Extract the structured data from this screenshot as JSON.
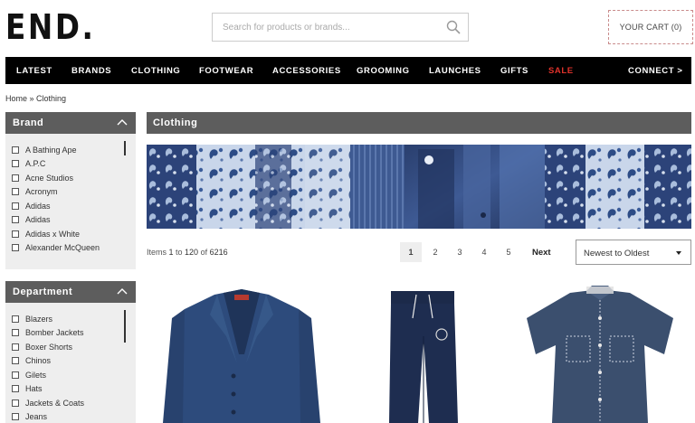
{
  "header": {
    "logo": "END.",
    "search_placeholder": "Search for products or brands...",
    "cart_label": "YOUR CART (0)"
  },
  "nav": {
    "items": [
      "LATEST",
      "BRANDS",
      "CLOTHING",
      "FOOTWEAR",
      "ACCESSORIES",
      "GROOMING",
      "LAUNCHES",
      "GIFTS",
      "SALE",
      "CONNECT >"
    ],
    "sale_color": "#e0322b"
  },
  "breadcrumb": {
    "home": "Home",
    "separator": " » ",
    "current": "Clothing"
  },
  "sidebar": {
    "brand": {
      "title": "Brand",
      "items": [
        "A Bathing Ape",
        "A.P.C",
        "Acne Studios",
        "Acronym",
        "Adidas",
        "Adidas",
        "Adidas x White",
        "Alexander McQueen"
      ]
    },
    "department": {
      "title": "Department",
      "items": [
        "Blazers",
        "Bomber Jackets",
        "Boxer Shorts",
        "Chinos",
        "Gilets",
        "Hats",
        "Jackets & Coats",
        "Jeans"
      ]
    }
  },
  "main": {
    "category_title": "Clothing",
    "items_prefix": "Items ",
    "items_from": "1",
    "items_to_word": " to ",
    "items_to": "120",
    "items_of_word": " of ",
    "items_total": "6216",
    "pages": [
      "1",
      "2",
      "3",
      "4",
      "5"
    ],
    "current_page": "1",
    "next_label": "Next",
    "sort_selected": "Newest to Oldest"
  },
  "colors": {
    "nav_bg": "#000000",
    "panel_head": "#5d5d5d",
    "panel_bg": "#eeeeee",
    "cart_border": "#c98b8b"
  }
}
